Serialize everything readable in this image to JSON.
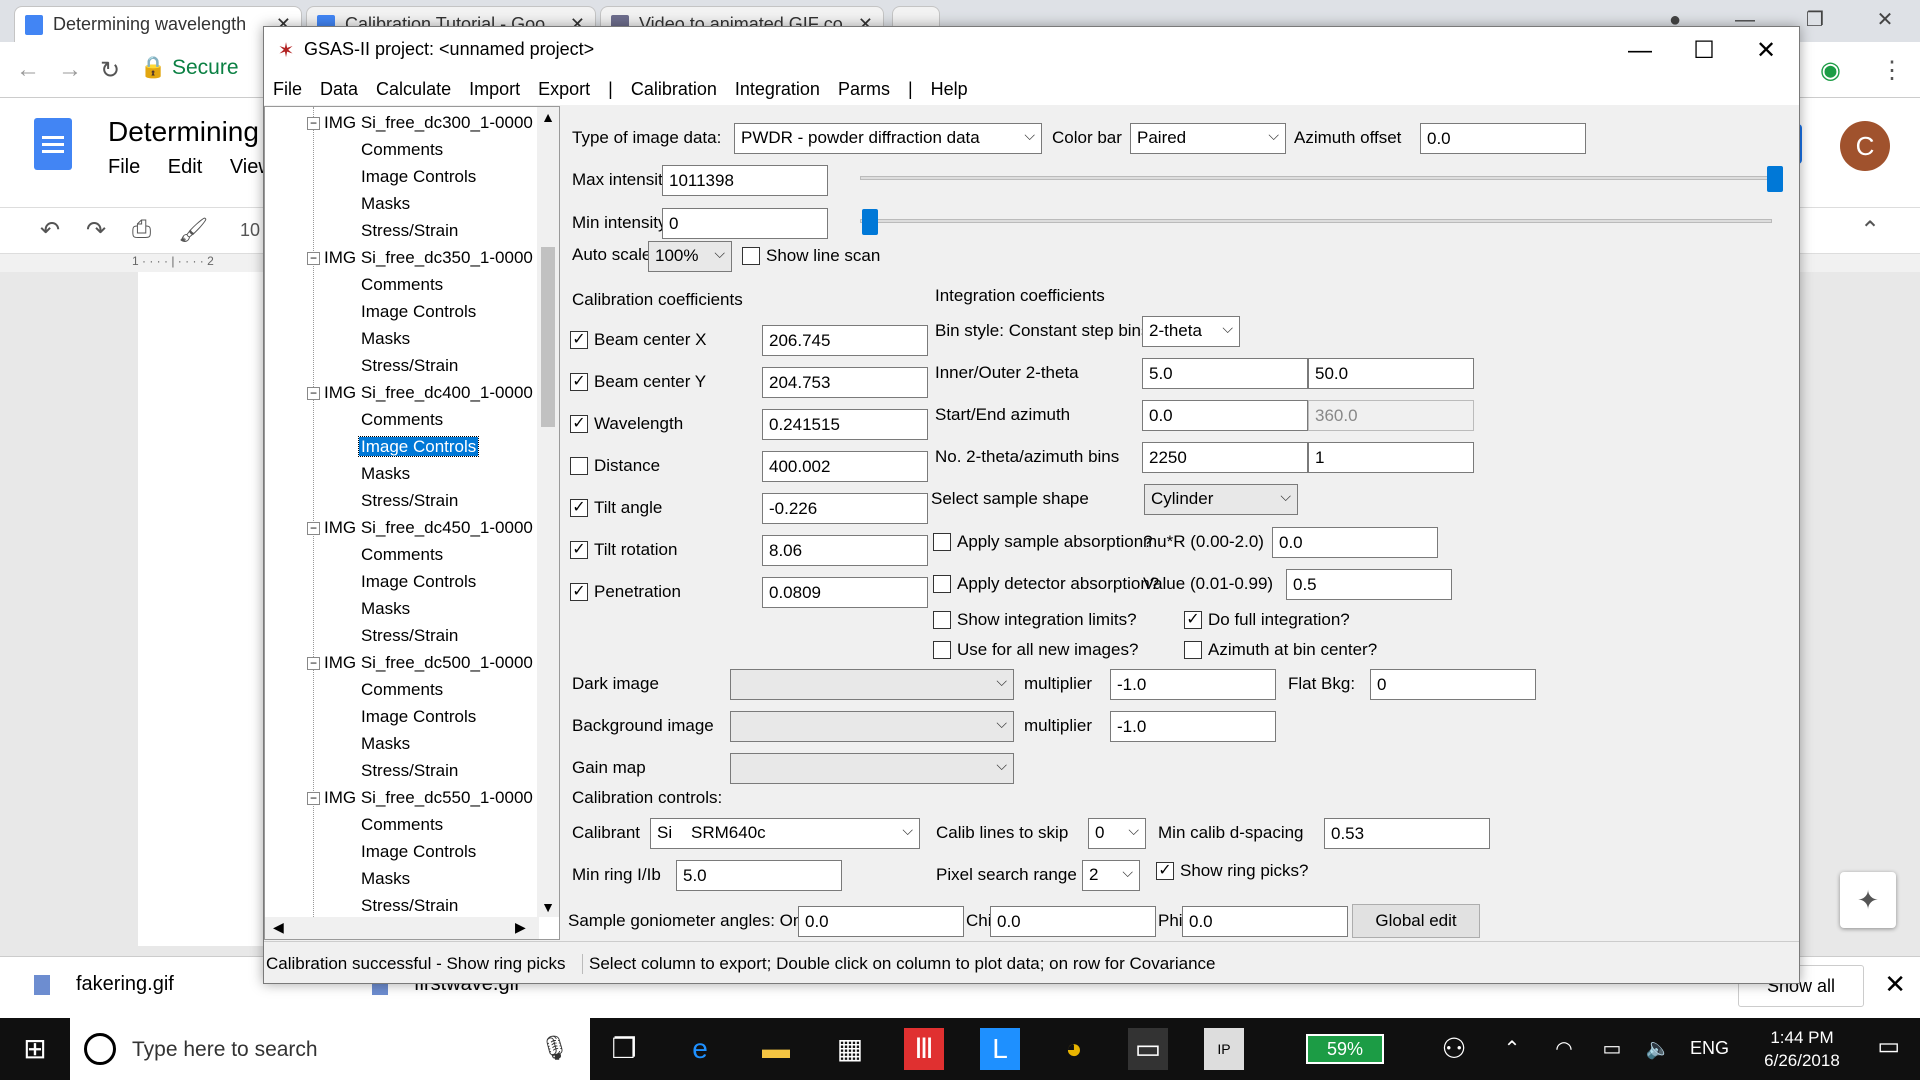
{
  "browser": {
    "tabs": [
      {
        "title": "Determining wavelength"
      },
      {
        "title": "Calibration Tutorial - Goo"
      },
      {
        "title": "Video to animated GIF co"
      }
    ],
    "secure_label": "Secure",
    "doc_title": "Determining",
    "doc_menu": [
      "File",
      "Edit",
      "View"
    ],
    "zoom": "10",
    "avatar_letter": "C"
  },
  "downloads": {
    "items": [
      "fakering.gif",
      "firstwave.gif"
    ],
    "show_all": "Show all"
  },
  "taskbar": {
    "search_placeholder": "Type here to search",
    "battery": "59%",
    "lang": "ENG",
    "time": "1:44 PM",
    "date": "6/26/2018",
    "notifications": "1"
  },
  "gsas": {
    "title": "GSAS-II project: <unnamed project>",
    "menu": [
      "File",
      "Data",
      "Calculate",
      "Import",
      "Export",
      "|",
      "Calibration",
      "Integration",
      "Parms",
      "|",
      "Help"
    ],
    "tree": [
      {
        "image": "IMG Si_free_dc300_1-0000",
        "children": [
          "Comments",
          "Image Controls",
          "Masks",
          "Stress/Strain"
        ]
      },
      {
        "image": "IMG Si_free_dc350_1-0000",
        "children": [
          "Comments",
          "Image Controls",
          "Masks",
          "Stress/Strain"
        ]
      },
      {
        "image": "IMG Si_free_dc400_1-0000",
        "children": [
          "Comments",
          "Image Controls",
          "Masks",
          "Stress/Strain"
        ]
      },
      {
        "image": "IMG Si_free_dc450_1-0000",
        "children": [
          "Comments",
          "Image Controls",
          "Masks",
          "Stress/Strain"
        ]
      },
      {
        "image": "IMG Si_free_dc500_1-0000",
        "children": [
          "Comments",
          "Image Controls",
          "Masks",
          "Stress/Strain"
        ]
      },
      {
        "image": "IMG Si_free_dc550_1-0000",
        "children": [
          "Comments",
          "Image Controls",
          "Masks",
          "Stress/Strain"
        ]
      }
    ],
    "selected": "Image Controls",
    "controls": {
      "type_label": "Type of image data:",
      "type_value": "PWDR - powder diffraction data",
      "colorbar_label": "Color bar",
      "colorbar_value": "Paired",
      "azoff_label": "Azimuth offset",
      "azoff_value": "0.0",
      "maxint_label": "Max intensity",
      "maxint_value": "1011398",
      "minint_label": "Min intensity",
      "minint_value": "0",
      "autoscaler_label": "Auto scaler",
      "autoscaler_value": "100%",
      "show_line_scan": "Show line scan",
      "calib_coef_header": "Calibration coefficients",
      "integ_coef_header": "Integration coefficients",
      "calib_rows": [
        {
          "label": "Beam center X",
          "value": "206.745",
          "checked": "✓"
        },
        {
          "label": "Beam center Y",
          "value": "204.753",
          "checked": "✓"
        },
        {
          "label": "Wavelength",
          "value": "0.241515",
          "checked": "✓"
        },
        {
          "label": "Distance",
          "value": "400.002",
          "checked": ""
        },
        {
          "label": "Tilt angle",
          "value": "-0.226",
          "checked": "✓"
        },
        {
          "label": "Tilt rotation",
          "value": "8.06",
          "checked": "✓"
        },
        {
          "label": "Penetration",
          "value": "0.0809",
          "checked": "✓"
        }
      ],
      "bin_style_label": "Bin style: Constant step bins in",
      "bin_style_value": "2-theta",
      "inner_outer_label": "Inner/Outer 2-theta",
      "inner_value": "5.0",
      "outer_value": "50.0",
      "start_end_label": "Start/End azimuth",
      "start_value": "0.0",
      "end_value": "360.0",
      "nbins_label": "No. 2-theta/azimuth bins",
      "nbins_2theta": "2250",
      "nbins_az": "1",
      "shape_label": "Select sample shape",
      "shape_value": "Cylinder",
      "apply_abs": "Apply sample absorption?",
      "mur_label": "mu*R (0.00-2.0)",
      "mur_value": "0.0",
      "apply_det_abs": "Apply detector absorption?",
      "det_value_label": "Value (0.01-0.99)",
      "det_value": "0.5",
      "show_int_limits": "Show integration limits?",
      "do_full_int": "Do full integration?",
      "use_all_new": "Use for all new images?",
      "az_bin_center": "Azimuth at bin center?",
      "dark_label": "Dark image",
      "dark_value": "",
      "mult_label": "multiplier",
      "dark_mult": "-1.0",
      "flatbkg_label": "Flat Bkg:",
      "flatbkg_value": "0",
      "bg_label": "Background image",
      "bg_value": "",
      "bg_mult": "-1.0",
      "gain_label": "Gain map",
      "gain_value": "",
      "calib_controls_header": "Calibration controls:",
      "calibrant_label": "Calibrant",
      "calibrant_value": "Si    SRM640c",
      "skip_label": "Calib lines to skip",
      "skip_value": "0",
      "min_d_label": "Min calib d-spacing",
      "min_d_value": "0.53",
      "min_ring_label": "Min ring I/Ib",
      "min_ring_value": "5.0",
      "pix_range_label": "Pixel search range",
      "pix_range_value": "2",
      "show_ring_picks": "Show ring picks?",
      "gonio_label": "Sample goniometer angles: Omega",
      "omega_value": "0.0",
      "chi_label": "Chi",
      "chi_value": "0.0",
      "phi_label": "Phi",
      "phi_value": "0.0",
      "global_edit": "Global edit"
    },
    "status_left": "Calibration successful - Show ring picks",
    "status_right": "Select column to export; Double click on column to plot data; on row for Covariance"
  }
}
